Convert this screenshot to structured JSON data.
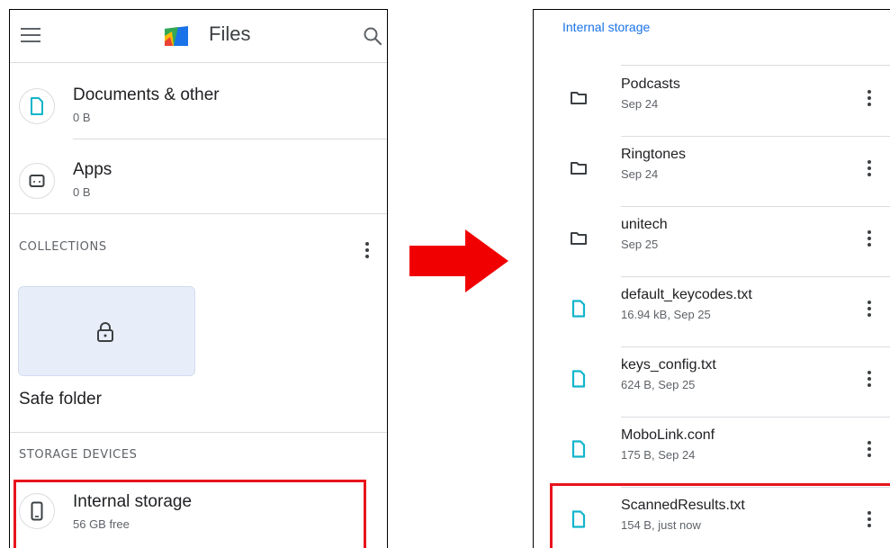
{
  "left": {
    "app_title": "Files",
    "categories": [
      {
        "title": "Documents & other",
        "sub": "0 B",
        "icon": "document-icon"
      },
      {
        "title": "Apps",
        "sub": "0 B",
        "icon": "apps-icon"
      }
    ],
    "collections_label": "COLLECTIONS",
    "safe_folder_label": "Safe folder",
    "storage_devices_label": "STORAGE DEVICES",
    "internal_storage": {
      "title": "Internal storage",
      "sub": "56 GB free"
    }
  },
  "right": {
    "breadcrumb": "Internal storage",
    "files": [
      {
        "name": "Podcasts",
        "meta": "Sep 24",
        "type": "folder"
      },
      {
        "name": "Ringtones",
        "meta": "Sep 24",
        "type": "folder"
      },
      {
        "name": "unitech",
        "meta": "Sep 25",
        "type": "folder"
      },
      {
        "name": "default_keycodes.txt",
        "meta": "16.94 kB, Sep 25",
        "type": "file"
      },
      {
        "name": "keys_config.txt",
        "meta": "624 B, Sep 25",
        "type": "file"
      },
      {
        "name": "MoboLink.conf",
        "meta": "175 B, Sep 24",
        "type": "file"
      },
      {
        "name": "ScannedResults.txt",
        "meta": "154 B, just now",
        "type": "file"
      }
    ]
  },
  "colors": {
    "accent": "#1a73e8",
    "file_icon": "#12b5cb",
    "highlight": "#e8141c",
    "arrow": "#f00000"
  }
}
